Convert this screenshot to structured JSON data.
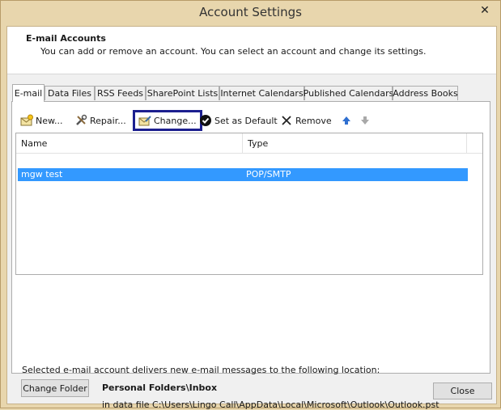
{
  "window": {
    "title": "Account Settings",
    "close_glyph": "✕"
  },
  "header": {
    "title": "E-mail Accounts",
    "subtitle": "You can add or remove an account. You can select an account and change its settings."
  },
  "tabs": [
    {
      "label": "E-mail",
      "active": true
    },
    {
      "label": "Data Files"
    },
    {
      "label": "RSS Feeds"
    },
    {
      "label": "SharePoint Lists"
    },
    {
      "label": "Internet Calendars"
    },
    {
      "label": "Published Calendars"
    },
    {
      "label": "Address Books"
    }
  ],
  "toolbar": {
    "new_label": "New...",
    "repair_label": "Repair...",
    "change_label": "Change...",
    "set_default_label": "Set as Default",
    "remove_label": "Remove"
  },
  "list": {
    "columns": [
      "Name",
      "Type"
    ],
    "rows": [
      {
        "name": "mgw test",
        "type": "POP/SMTP",
        "selected": true
      }
    ]
  },
  "delivery": {
    "text": "Selected e-mail account delivers new e-mail messages to the following location:",
    "change_folder_label": "Change Folder",
    "folder": "Personal Folders\\Inbox",
    "data_file": "in data file C:\\Users\\Lingo Call\\AppData\\Local\\Microsoft\\Outlook\\Outlook.pst"
  },
  "footer": {
    "close_label": "Close"
  },
  "colors": {
    "accent_selection": "#3399ff",
    "highlight_box": "#1c1f8f",
    "chrome": "#e8d6ad"
  }
}
